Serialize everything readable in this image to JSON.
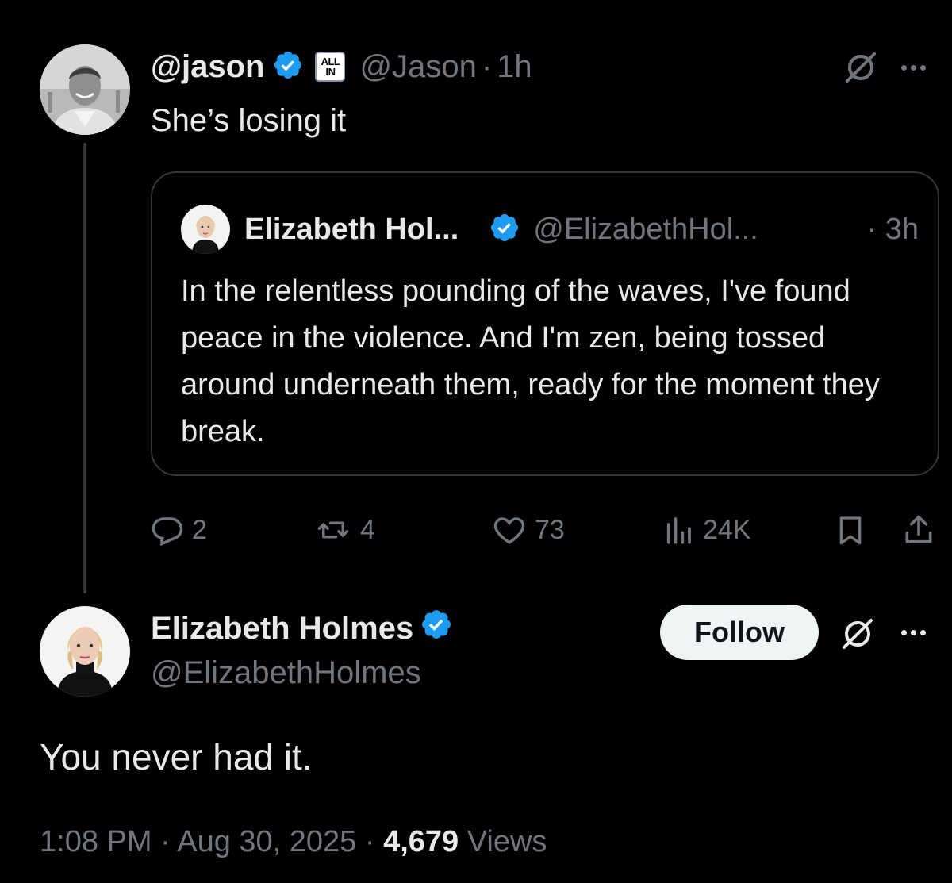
{
  "parent_tweet": {
    "author_name": "@jason",
    "affiliation_badge": "ALL IN",
    "affiliation_lines": [
      "ALL",
      "IN"
    ],
    "handle": "@Jason",
    "separator": "·",
    "time": "1h",
    "text": "She’s losing it",
    "icons": [
      "verified-icon",
      "grok-icon",
      "more-icon"
    ],
    "quoted": {
      "author_name": "Elizabeth Hol...",
      "handle": "@ElizabethHol...",
      "time": "· 3h",
      "text": "In the relentless pounding of the waves, I've found peace in the violence. And I'm zen, being tossed around underneath them, ready for the moment they break."
    },
    "actions": {
      "replies": "2",
      "reposts": "4",
      "likes": "73",
      "views": "24K"
    }
  },
  "main_tweet": {
    "author_name": "Elizabeth Holmes",
    "handle": "@ElizabethHolmes",
    "follow_label": "Follow",
    "text": "You never had it.",
    "time": "1:08 PM",
    "date": "Aug 30, 2025",
    "separator": "·",
    "views_count": "4,679",
    "views_label": "Views"
  },
  "colors": {
    "background": "#000000",
    "text_primary": "#e7e9ea",
    "text_secondary": "#71767b",
    "verified_blue": "#1d9bf0",
    "border": "#333639",
    "follow_button_bg": "#eff3f4"
  }
}
